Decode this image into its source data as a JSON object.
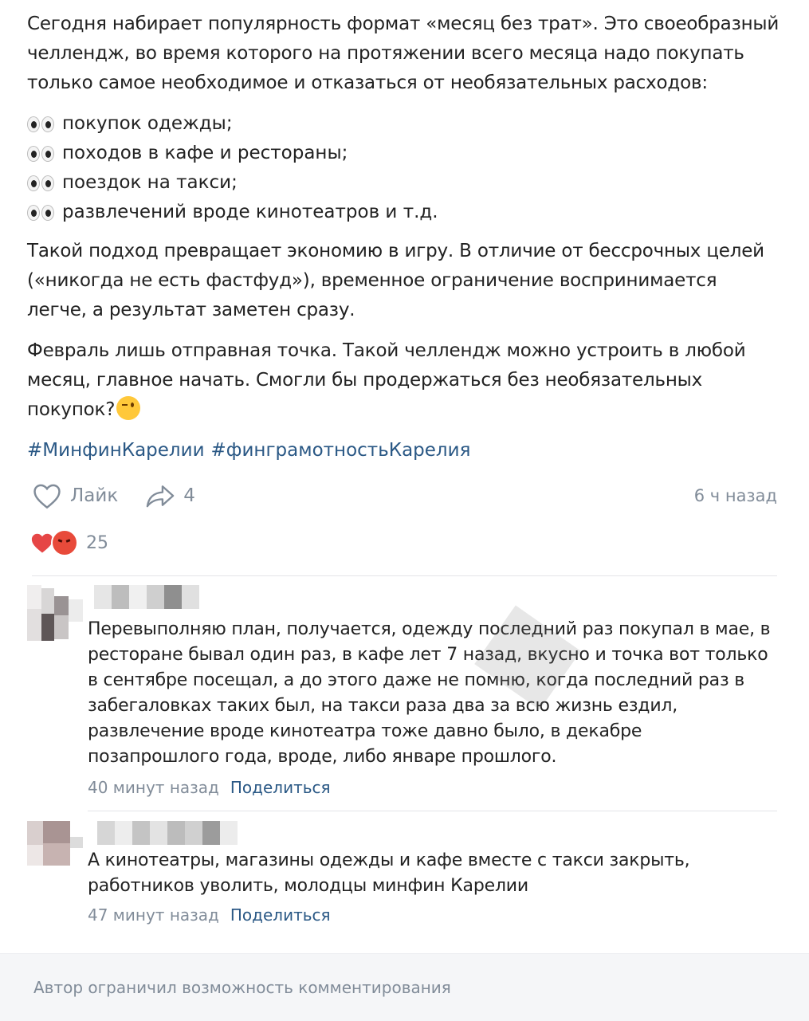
{
  "post": {
    "intro": "Сегодня набирает популярность формат «месяц без трат». Это своеобразный челлендж, во время которого на протяжении всего месяца надо покупать только самое необходимое и отказаться от необязательных расходов:",
    "list": [
      "покупок одежды;",
      "походов в кафе и рестораны;",
      "поездок на такси;",
      "развлечений вроде кинотеатров и т.д."
    ],
    "para2": "Такой подход превращает экономию в игру. В отличие от бессрочных целей («никогда не есть фастфуд»), временное ограничение воспринимается легче, а результат заметен сразу.",
    "para3": "Февраль лишь отправная точка. Такой челлендж можно устроить в любой месяц, главное начать. Смогли бы продержаться без необязательных покупок?",
    "hashtags": [
      "#МинфинКарелии",
      "#финграмотностьКарелия"
    ]
  },
  "actions": {
    "like_label": "Лайк",
    "share_count": "4",
    "time": "6 ч назад"
  },
  "reactions": {
    "count": "25"
  },
  "comments": [
    {
      "text": "Перевыполняю план, получается, одежду последний раз покупал в мае, в ресторане бывал один раз, в кафе лет 7 назад, вкусно и точка вот только в сентябре посещал, а до этого даже не помню, когда последний раз в забегаловках таких был, на такси раза два за всю жизнь ездил, развлечение вроде кинотеатра тоже давно было, в декабре позапрошлого года, вроде, либо январе прошлого.",
      "time": "40 минут назад",
      "share_label": "Поделиться"
    },
    {
      "text": "А кинотеатры, магазины одежды и кафе вместе с такси закрыть, работников уволить, молодцы минфин Карелии",
      "time": "47 минут назад",
      "share_label": "Поделиться"
    }
  ],
  "footer": {
    "notice": "Автор ограничил возможность комментирования"
  },
  "colors": {
    "link": "#2a5885",
    "muted": "#818c99",
    "heart": "#e64646"
  }
}
